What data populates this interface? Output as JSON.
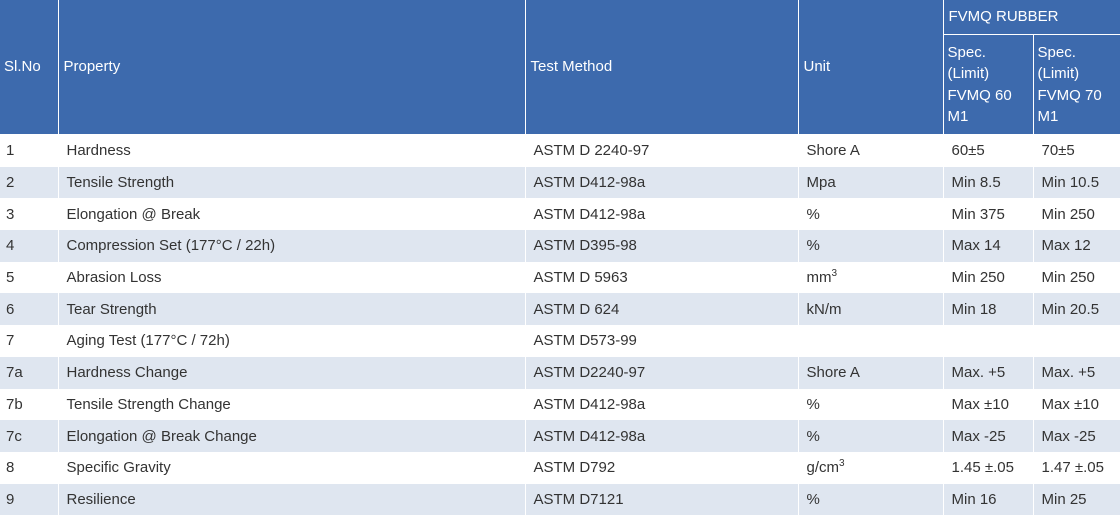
{
  "header": {
    "sl_no": "Sl.No",
    "property": "Property",
    "test_method": "Test Method",
    "unit": "Unit",
    "group": "FVMQ RUBBER",
    "spec_60": "Spec. (Limit) FVMQ 60 M1",
    "spec_70": "Spec. (Limit) FVMQ 70 M1"
  },
  "rows": [
    {
      "sl": "1",
      "property": "Hardness",
      "method": "ASTM D 2240-97",
      "unit": "Shore A",
      "spec60": "60±5",
      "spec70": "70±5"
    },
    {
      "sl": "2",
      "property": "Tensile Strength",
      "method": "ASTM D412-98a",
      "unit": "Mpa",
      "spec60": "Min 8.5",
      "spec70": "Min 10.5"
    },
    {
      "sl": "3",
      "property": "Elongation @ Break",
      "method": "ASTM D412-98a",
      "unit": "%",
      "spec60": "Min 375",
      "spec70": "Min 250"
    },
    {
      "sl": "4",
      "property": "Compression Set (177°C / 22h)",
      "method": "ASTM D395-98",
      "unit": "%",
      "spec60": "Max 14",
      "spec70": "Max 12"
    },
    {
      "sl": "5",
      "property": "Abrasion Loss",
      "method": "ASTM D 5963",
      "unit": "mm",
      "unit_sup": "3",
      "spec60": "Min 250",
      "spec70": "Min 250"
    },
    {
      "sl": "6",
      "property": "Tear Strength",
      "method": "ASTM D 624",
      "unit": "kN/m",
      "spec60": "Min 18",
      "spec70": "Min 20.5"
    },
    {
      "sl": "7",
      "property": "Aging Test (177°C / 72h)",
      "method": "ASTM D573-99",
      "unit": "",
      "spec60": "",
      "spec70": ""
    },
    {
      "sl": "7a",
      "property": "Hardness Change",
      "method": "ASTM D2240-97",
      "unit": "Shore A",
      "spec60": "Max. +5",
      "spec70": "Max. +5"
    },
    {
      "sl": "7b",
      "property": "Tensile Strength Change",
      "method": "ASTM D412-98a",
      "unit": "%",
      "spec60": "Max ±10",
      "spec70": "Max ±10"
    },
    {
      "sl": "7c",
      "property": "Elongation @ Break Change",
      "method": "ASTM D412-98a",
      "unit": "%",
      "spec60": "Max -25",
      "spec70": "Max -25"
    },
    {
      "sl": "8",
      "property": "Specific Gravity",
      "method": "ASTM D792",
      "unit": "g/cm",
      "unit_sup": "3",
      "spec60": "1.45 ±.05",
      "spec70": "1.47 ±.05"
    },
    {
      "sl": "9",
      "property": "Resilience",
      "method": "ASTM D7121",
      "unit": "%",
      "spec60": "Min 16",
      "spec70": "Min 25"
    }
  ]
}
